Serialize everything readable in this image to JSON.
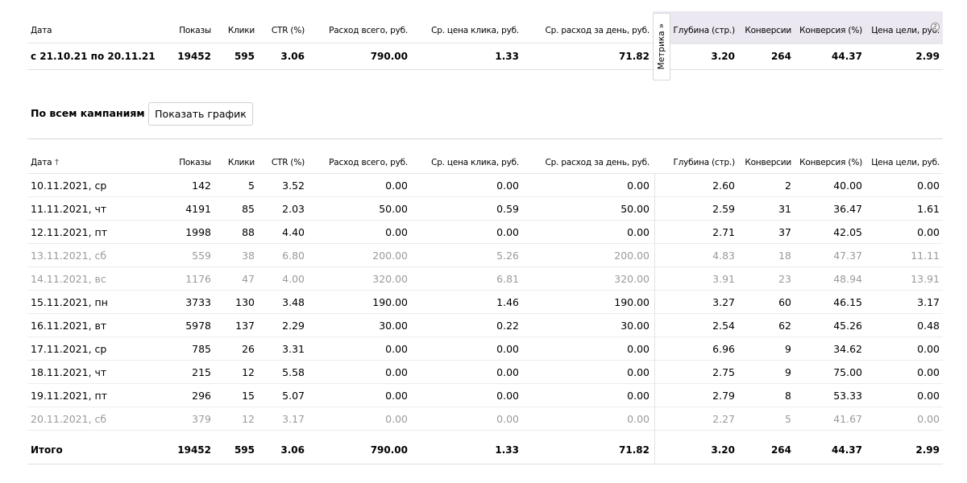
{
  "headers": [
    "Дата",
    "Показы",
    "Клики",
    "CTR (%)",
    "Расход всего, руб.",
    "Ср. цена клика, руб.",
    "Ср. расход за день, руб.",
    "Глубина (стр.)",
    "Конверсии",
    "Конверсия (%)",
    "Цена цели, руб."
  ],
  "summary": {
    "values": [
      "с 21.10.21 по 20.11.21",
      "19452",
      "595",
      "3.06",
      "790.00",
      "1.33",
      "71.82",
      "3.20",
      "264",
      "44.37",
      "2.99"
    ]
  },
  "metrika_tab": {
    "label": "Метрика",
    "chevron": "»",
    "icon": "chevron-double-icon"
  },
  "help_icon": {
    "glyph": "?",
    "icon": "help-circle-icon"
  },
  "campaigns": {
    "label": "По всем кампаниям",
    "chart_button_label": "Показать график"
  },
  "daily": {
    "sort_arrow": "↑",
    "rows": [
      {
        "muted": false,
        "cells": [
          "10.11.2021, ср",
          "142",
          "5",
          "3.52",
          "0.00",
          "0.00",
          "0.00",
          "2.60",
          "2",
          "40.00",
          "0.00"
        ]
      },
      {
        "muted": false,
        "cells": [
          "11.11.2021, чт",
          "4191",
          "85",
          "2.03",
          "50.00",
          "0.59",
          "50.00",
          "2.59",
          "31",
          "36.47",
          "1.61"
        ]
      },
      {
        "muted": false,
        "cells": [
          "12.11.2021, пт",
          "1998",
          "88",
          "4.40",
          "0.00",
          "0.00",
          "0.00",
          "2.71",
          "37",
          "42.05",
          "0.00"
        ]
      },
      {
        "muted": true,
        "cells": [
          "13.11.2021, сб",
          "559",
          "38",
          "6.80",
          "200.00",
          "5.26",
          "200.00",
          "4.83",
          "18",
          "47.37",
          "11.11"
        ]
      },
      {
        "muted": true,
        "cells": [
          "14.11.2021, вс",
          "1176",
          "47",
          "4.00",
          "320.00",
          "6.81",
          "320.00",
          "3.91",
          "23",
          "48.94",
          "13.91"
        ]
      },
      {
        "muted": false,
        "cells": [
          "15.11.2021, пн",
          "3733",
          "130",
          "3.48",
          "190.00",
          "1.46",
          "190.00",
          "3.27",
          "60",
          "46.15",
          "3.17"
        ]
      },
      {
        "muted": false,
        "cells": [
          "16.11.2021, вт",
          "5978",
          "137",
          "2.29",
          "30.00",
          "0.22",
          "30.00",
          "2.54",
          "62",
          "45.26",
          "0.48"
        ]
      },
      {
        "muted": false,
        "cells": [
          "17.11.2021, ср",
          "785",
          "26",
          "3.31",
          "0.00",
          "0.00",
          "0.00",
          "6.96",
          "9",
          "34.62",
          "0.00"
        ]
      },
      {
        "muted": false,
        "cells": [
          "18.11.2021, чт",
          "215",
          "12",
          "5.58",
          "0.00",
          "0.00",
          "0.00",
          "2.75",
          "9",
          "75.00",
          "0.00"
        ]
      },
      {
        "muted": false,
        "cells": [
          "19.11.2021, пт",
          "296",
          "15",
          "5.07",
          "0.00",
          "0.00",
          "0.00",
          "2.79",
          "8",
          "53.33",
          "0.00"
        ]
      },
      {
        "muted": true,
        "cells": [
          "20.11.2021, сб",
          "379",
          "12",
          "3.17",
          "0.00",
          "0.00",
          "0.00",
          "2.27",
          "5",
          "41.67",
          "0.00"
        ]
      }
    ],
    "total": [
      "Итого",
      "19452",
      "595",
      "3.06",
      "790.00",
      "1.33",
      "71.82",
      "3.20",
      "264",
      "44.37",
      "2.99"
    ]
  }
}
